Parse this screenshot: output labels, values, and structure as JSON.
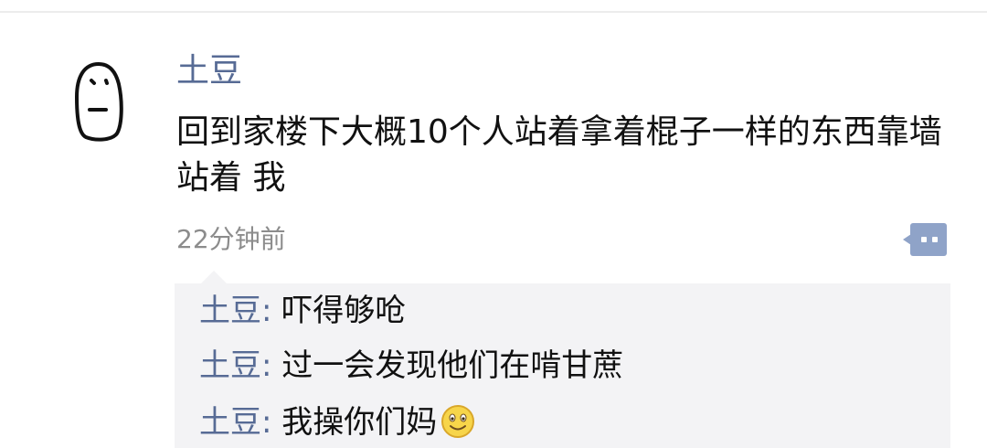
{
  "post": {
    "author": "土豆",
    "text": "回到家楼下大概10个人站着拿着棍子一样的东西靠墙站着 我",
    "timestamp": "22分钟前"
  },
  "icons": {
    "avatar": "doodle-face-avatar",
    "comment_button": "comment-dots-icon",
    "emoji": "smile-emoji"
  },
  "colors": {
    "name": "#576b95",
    "text": "#111111",
    "meta": "#8c8c8c",
    "comment_bg": "#f3f3f5",
    "comment_icon": "#8fa3c8"
  },
  "comments": [
    {
      "author": "土豆",
      "separator": ":",
      "text": "吓得够呛"
    },
    {
      "author": "土豆",
      "separator": ":",
      "text": "过一会发现他们在啃甘蔗"
    },
    {
      "author": "土豆",
      "separator": ":",
      "text": "我操你们妈"
    }
  ]
}
